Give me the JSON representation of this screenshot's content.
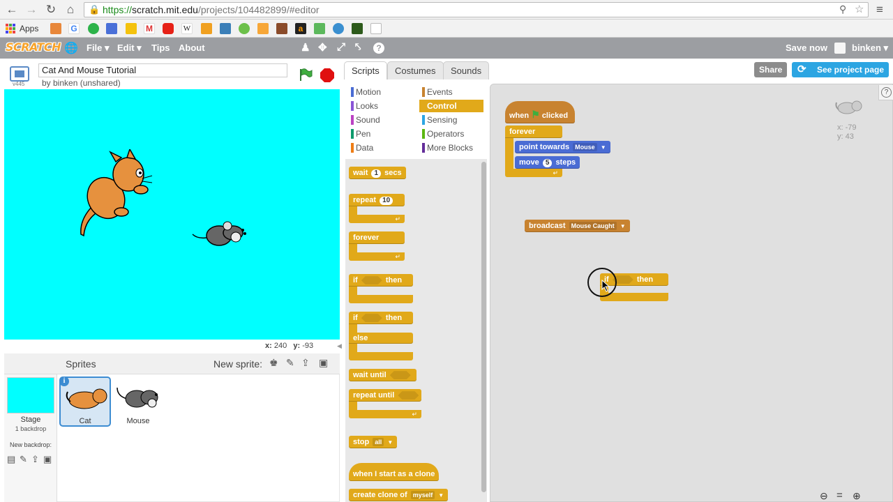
{
  "browser": {
    "url_scheme": "https://",
    "url_host": "scratch.mit.edu",
    "url_path": "/projects/104482899/#editor",
    "apps_label": "Apps"
  },
  "menubar": {
    "logo": "SCRATCH",
    "file": "File ▾",
    "edit": "Edit ▾",
    "tips": "Tips",
    "about": "About",
    "save_now": "Save now",
    "user": "binken ▾"
  },
  "project": {
    "title": "Cat And Mouse Tutorial",
    "byline": "by binken (unshared)",
    "version": "v445"
  },
  "stage": {
    "coords_x_label": "x:",
    "coords_x": "240",
    "coords_y_label": "y:",
    "coords_y": "-93",
    "background": "#00ffff"
  },
  "tabs": {
    "scripts": "Scripts",
    "costumes": "Costumes",
    "sounds": "Sounds"
  },
  "buttons": {
    "share": "Share",
    "see_project": "See project page"
  },
  "categories": [
    {
      "label": "Motion",
      "color": "#4a6cd4"
    },
    {
      "label": "Looks",
      "color": "#8a55d7"
    },
    {
      "label": "Sound",
      "color": "#bb42c3"
    },
    {
      "label": "Pen",
      "color": "#0e9a6c"
    },
    {
      "label": "Data",
      "color": "#ee7d16"
    },
    {
      "label": "Events",
      "color": "#c88330"
    },
    {
      "label": "Control",
      "color": "#e1a91a"
    },
    {
      "label": "Sensing",
      "color": "#2ca5e2"
    },
    {
      "label": "Operators",
      "color": "#5cb712"
    },
    {
      "label": "More Blocks",
      "color": "#632d99"
    }
  ],
  "palette": {
    "wait": "wait",
    "wait_val": "1",
    "secs": "secs",
    "repeat": "repeat",
    "repeat_val": "10",
    "forever": "forever",
    "if": "if",
    "then": "then",
    "else": "else",
    "wait_until": "wait until",
    "repeat_until": "repeat until",
    "stop": "stop",
    "stop_val": "all",
    "when_clone": "when I start as a clone",
    "create_clone": "create clone of",
    "clone_val": "myself"
  },
  "scripts": {
    "when": "when",
    "clicked": "clicked",
    "forever": "forever",
    "point_towards": "point towards",
    "point_val": "Mouse",
    "move": "move",
    "move_val": "5",
    "steps": "steps",
    "broadcast": "broadcast",
    "broadcast_val": "Mouse Caught",
    "if": "if",
    "then": "then",
    "sprite_x": "x: -79",
    "sprite_y": "y: 43"
  },
  "sprites": {
    "header": "Sprites",
    "new_sprite": "New sprite:",
    "stage_label": "Stage",
    "backdrops": "1 backdrop",
    "new_backdrop": "New backdrop:",
    "items": [
      {
        "name": "Cat",
        "selected": true
      },
      {
        "name": "Mouse",
        "selected": false
      }
    ]
  }
}
